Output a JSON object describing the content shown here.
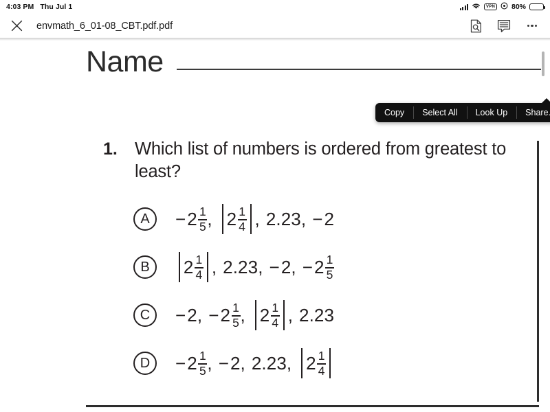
{
  "status_bar": {
    "time": "4:03 PM",
    "date": "Thu Jul 1",
    "signal_icon": "cellular-signal-icon",
    "wifi_icon": "wifi-icon",
    "vpn_label": "VPN",
    "lock_icon": "rotation-lock-icon",
    "battery_percent": "80%",
    "battery_icon": "battery-icon"
  },
  "toolbar": {
    "close_icon": "close-icon",
    "document_title": "envmath_6_01-08_CBT.pdf.pdf",
    "search_icon": "document-search-icon",
    "markup_icon": "markup-annotation-icon",
    "more_icon": "more-options-icon"
  },
  "context_menu": {
    "items": [
      {
        "label": "Copy",
        "name": "copy"
      },
      {
        "label": "Select All",
        "name": "select-all"
      },
      {
        "label": "Look Up",
        "name": "look-up"
      },
      {
        "label": "Share...",
        "name": "share"
      }
    ]
  },
  "document": {
    "name_label": "Name",
    "question": {
      "number": "1.",
      "text": "Which list of numbers is ordered from greatest to least?"
    },
    "choices": [
      {
        "letter": "A",
        "plain": "−2 1/5, |2 1/4|, 2.23, −2",
        "terms": [
          {
            "type": "mixed",
            "sign": "−",
            "whole": "2",
            "num": "1",
            "den": "5",
            "abs": false
          },
          {
            "type": "mixed",
            "sign": "",
            "whole": "2",
            "num": "1",
            "den": "4",
            "abs": true
          },
          {
            "type": "decimal",
            "sign": "",
            "value": "2.23",
            "abs": false
          },
          {
            "type": "integer",
            "sign": "−",
            "value": "2",
            "abs": false
          }
        ]
      },
      {
        "letter": "B",
        "plain": "|2 1/4|, 2.23, −2, −2 1/5",
        "terms": [
          {
            "type": "mixed",
            "sign": "",
            "whole": "2",
            "num": "1",
            "den": "4",
            "abs": true
          },
          {
            "type": "decimal",
            "sign": "",
            "value": "2.23",
            "abs": false
          },
          {
            "type": "integer",
            "sign": "−",
            "value": "2",
            "abs": false
          },
          {
            "type": "mixed",
            "sign": "−",
            "whole": "2",
            "num": "1",
            "den": "5",
            "abs": false
          }
        ]
      },
      {
        "letter": "C",
        "plain": "−2, −2 1/5, |2 1/4|, 2.23",
        "terms": [
          {
            "type": "integer",
            "sign": "−",
            "value": "2",
            "abs": false
          },
          {
            "type": "mixed",
            "sign": "−",
            "whole": "2",
            "num": "1",
            "den": "5",
            "abs": false
          },
          {
            "type": "mixed",
            "sign": "",
            "whole": "2",
            "num": "1",
            "den": "4",
            "abs": true
          },
          {
            "type": "decimal",
            "sign": "",
            "value": "2.23",
            "abs": false
          }
        ]
      },
      {
        "letter": "D",
        "plain": "−2 1/5, −2, 2.23, |2 1/4|",
        "terms": [
          {
            "type": "mixed",
            "sign": "−",
            "whole": "2",
            "num": "1",
            "den": "5",
            "abs": false
          },
          {
            "type": "integer",
            "sign": "−",
            "value": "2",
            "abs": false
          },
          {
            "type": "decimal",
            "sign": "",
            "value": "2.23",
            "abs": false
          },
          {
            "type": "mixed",
            "sign": "",
            "whole": "2",
            "num": "1",
            "den": "4",
            "abs": true
          }
        ]
      }
    ]
  },
  "colors": {
    "ink": "#231f20",
    "menu_bg": "#111111",
    "toolbar_text": "#1c1c1c",
    "scrollbar": "#b4b4b4"
  }
}
